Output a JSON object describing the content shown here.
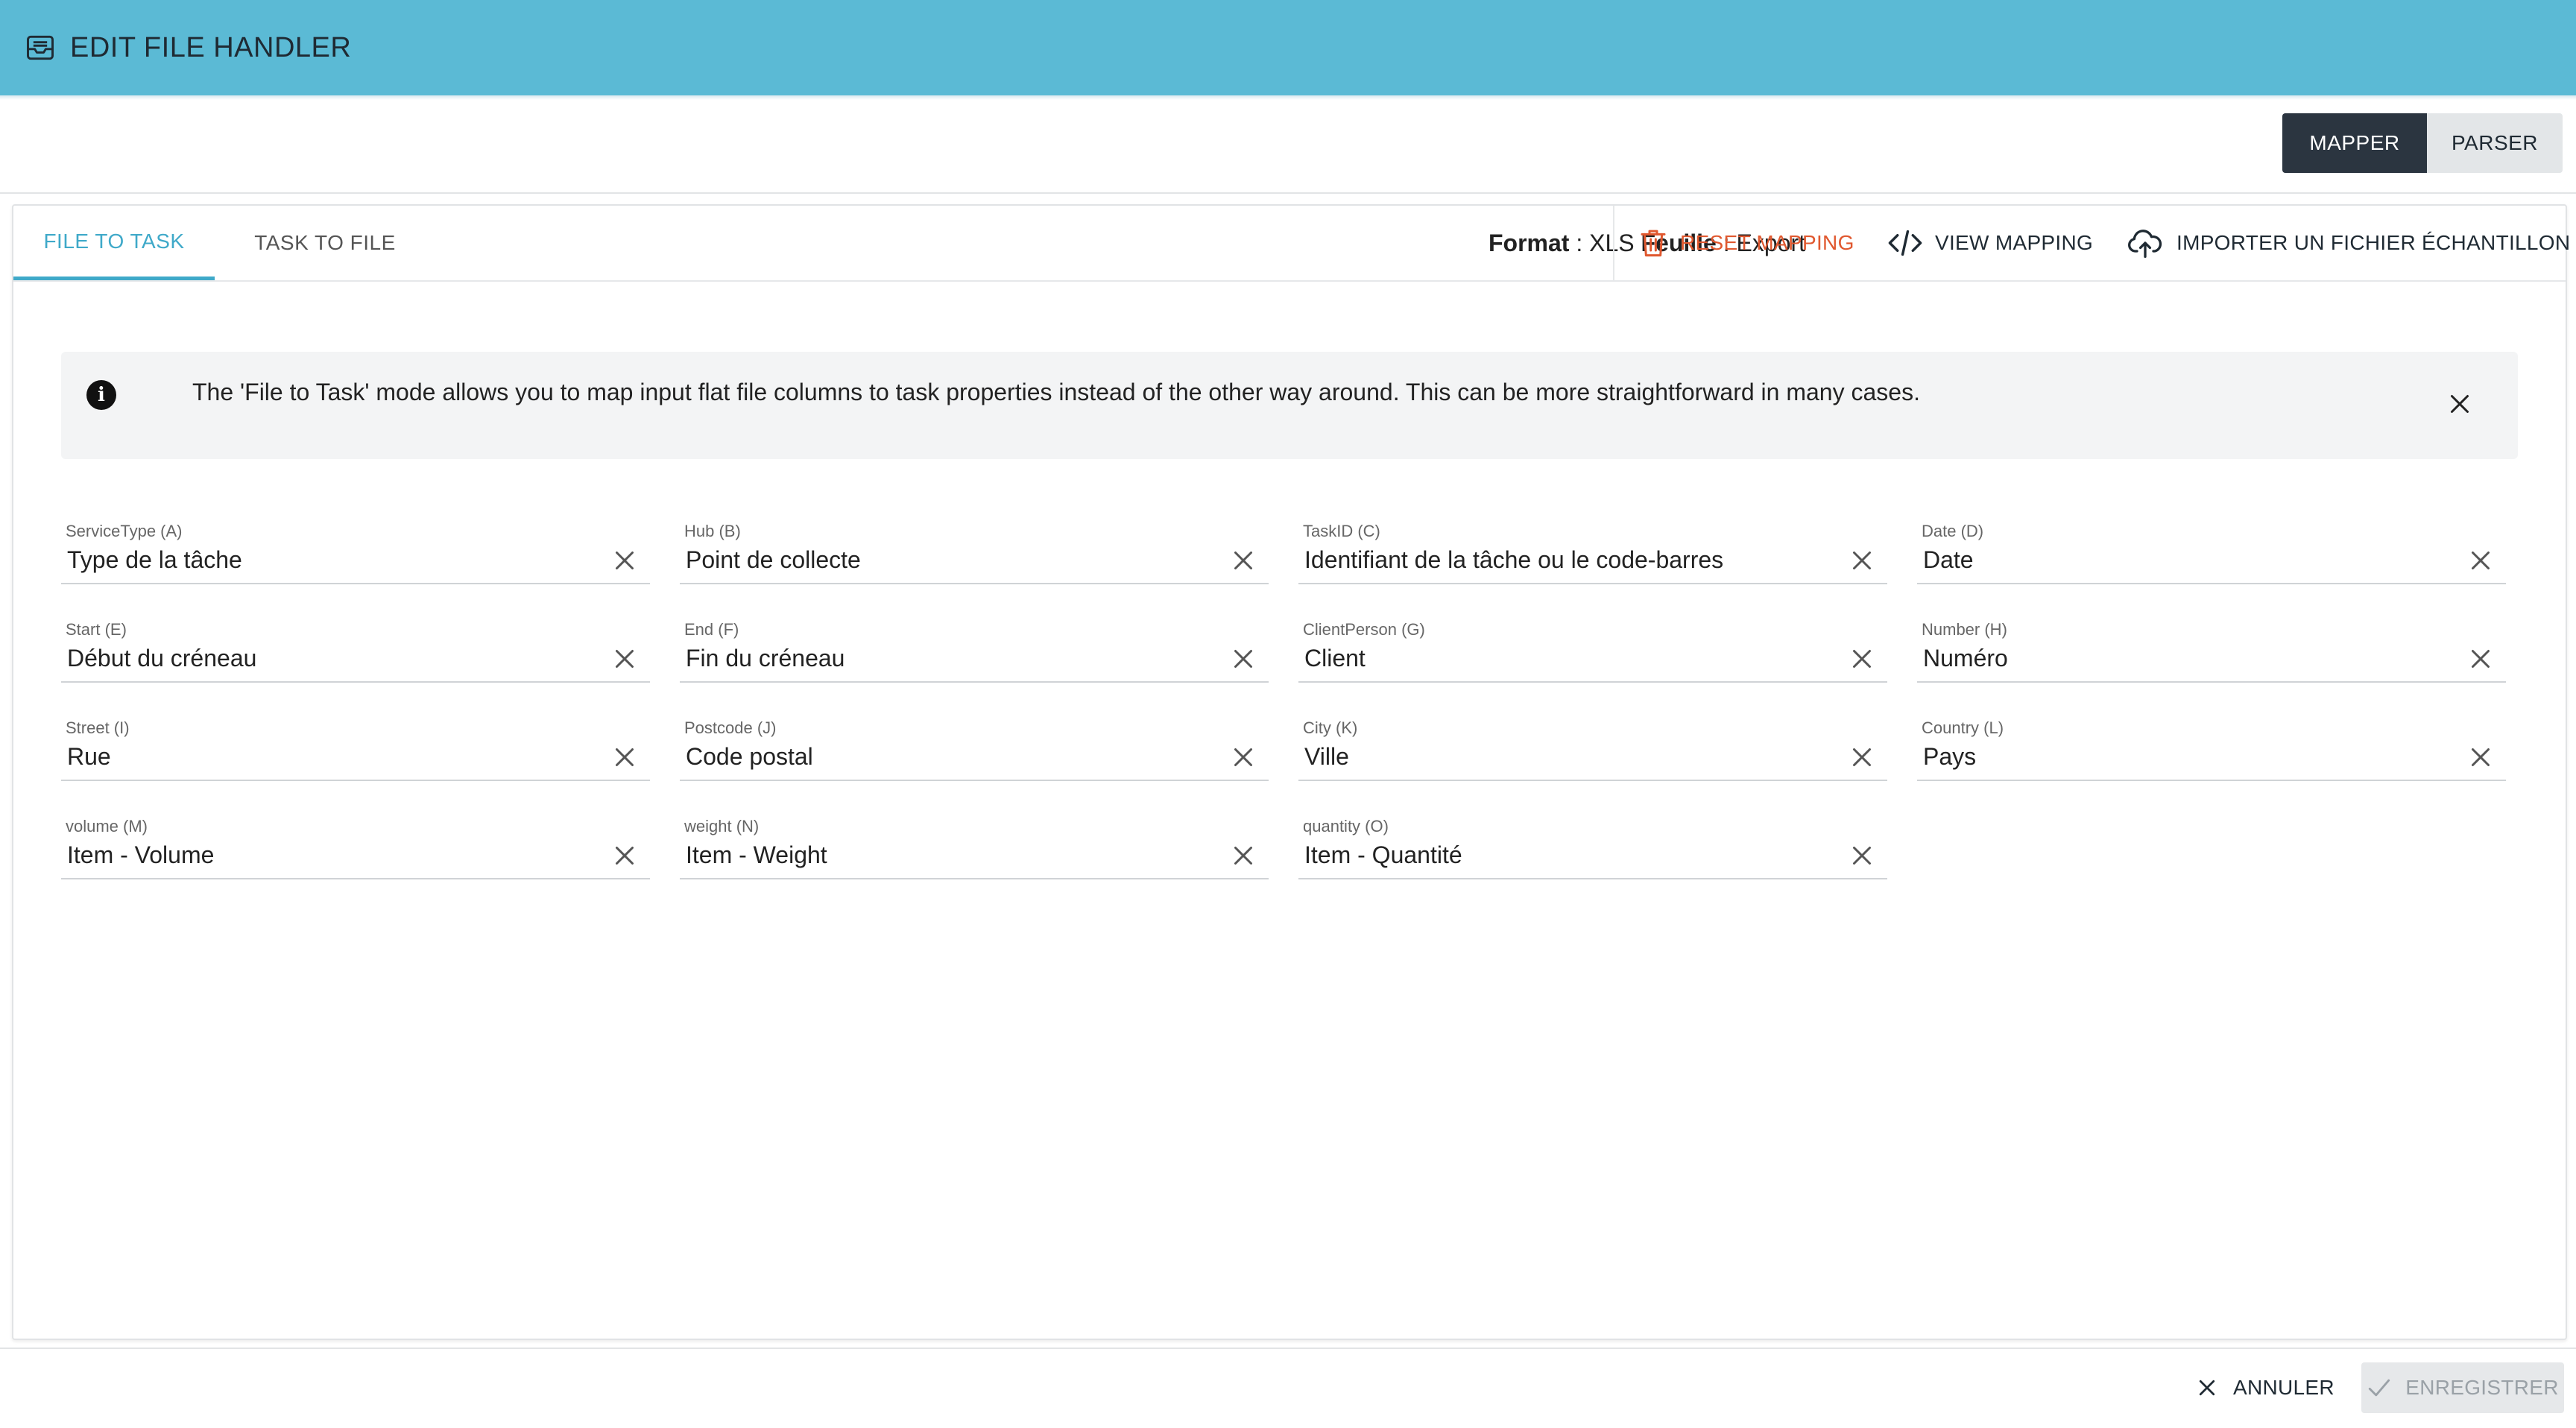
{
  "header": {
    "title": "EDIT FILE HANDLER",
    "icon": "inbox-icon"
  },
  "mode_toggle": {
    "active": "MAPPER",
    "inactive": "PARSER"
  },
  "tabs": [
    {
      "label": "FILE TO TASK",
      "active": true
    },
    {
      "label": "TASK TO FILE",
      "active": false
    }
  ],
  "format_info": {
    "format_label": "Format",
    "format_value": "XLS",
    "sheet_label": "Feuille",
    "sheet_value": "Export"
  },
  "actions": {
    "reset": "RESET MAPPING",
    "view": "VIEW MAPPING",
    "import": "IMPORTER UN FICHIER ÉCHANTILLON"
  },
  "info_message": "The 'File to Task' mode allows you to map input flat file columns to task properties instead of the other way around. This can be more straightforward in many cases.",
  "fields": [
    {
      "label": "ServiceType (A)",
      "value": "Type de la tâche"
    },
    {
      "label": "Hub (B)",
      "value": "Point de collecte"
    },
    {
      "label": "TaskID (C)",
      "value": "Identifiant de la tâche ou le code-barres"
    },
    {
      "label": "Date (D)",
      "value": "Date"
    },
    {
      "label": "Start (E)",
      "value": "Début du créneau"
    },
    {
      "label": "End (F)",
      "value": "Fin du créneau"
    },
    {
      "label": "ClientPerson (G)",
      "value": "Client"
    },
    {
      "label": "Number (H)",
      "value": "Numéro"
    },
    {
      "label": "Street (I)",
      "value": "Rue"
    },
    {
      "label": "Postcode (J)",
      "value": "Code postal"
    },
    {
      "label": "City (K)",
      "value": "Ville"
    },
    {
      "label": "Country (L)",
      "value": "Pays"
    },
    {
      "label": "volume (M)",
      "value": "Item - Volume"
    },
    {
      "label": "weight (N)",
      "value": "Item - Weight"
    },
    {
      "label": "quantity (O)",
      "value": "Item - Quantité"
    }
  ],
  "footer": {
    "cancel": "ANNULER",
    "save": "ENREGISTRER"
  },
  "colors": {
    "header_bg": "#5bbad5",
    "accent": "#3fa9c9",
    "danger": "#e0582f",
    "toggle_active": "#2b3540"
  }
}
